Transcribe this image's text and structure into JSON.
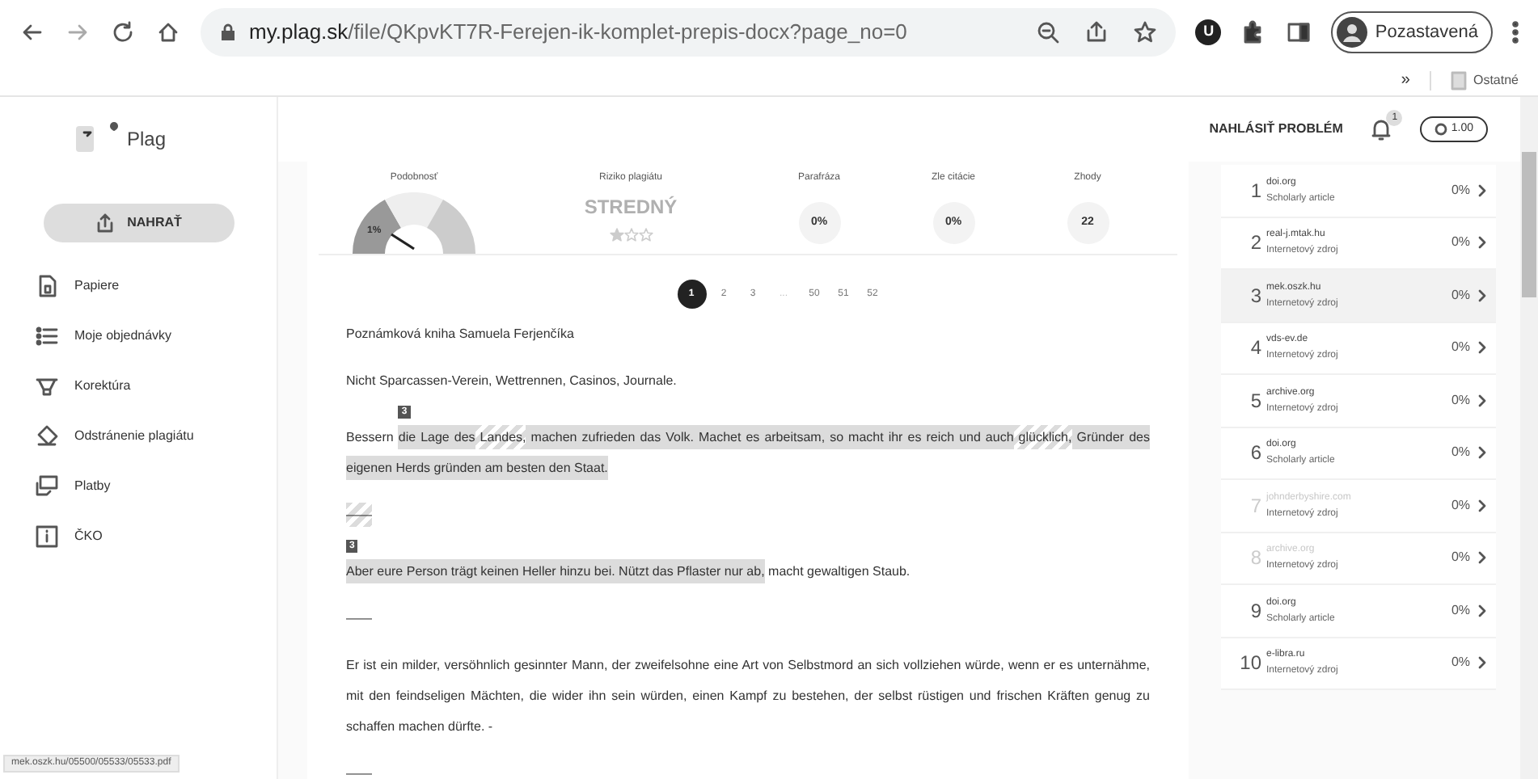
{
  "browser": {
    "url_host": "my.plag.sk",
    "url_path": "/file/QKpvKT7R-Ferejen-ik-komplet-prepis-docx?page_no=0",
    "extension_badge": "U",
    "profile": "Pozastavená",
    "bookmarks_more": "»",
    "bookmarks_folder": "Ostatné"
  },
  "sidebar": {
    "logo": "Plag",
    "upload_button": "NAHRAŤ",
    "items": [
      {
        "label": "Papiere"
      },
      {
        "label": "Moje objednávky"
      },
      {
        "label": "Korektúra"
      },
      {
        "label": "Odstránenie plagiátu"
      },
      {
        "label": "Platby"
      },
      {
        "label": "ČKO"
      }
    ]
  },
  "header": {
    "report_link": "NAHLÁSIŤ PROBLÉM",
    "notification_count": "1",
    "credits": "1.00"
  },
  "stats": {
    "similarity": {
      "label": "Podobnosť",
      "value": "1%"
    },
    "risk": {
      "label": "Riziko plagiátu",
      "value": "STREDNÝ",
      "stars": 1
    },
    "circles": [
      {
        "label": "Parafráza",
        "value": "0%"
      },
      {
        "label": "Zle citácie",
        "value": "0%"
      },
      {
        "label": "Zhody",
        "value": "22"
      }
    ]
  },
  "pagination": [
    {
      "label": "1",
      "selected": true,
      "kind": "page"
    },
    {
      "label": "2",
      "selected": false,
      "kind": "page"
    },
    {
      "label": "3",
      "selected": false,
      "kind": "page"
    },
    {
      "label": "...",
      "kind": "ellipsis"
    },
    {
      "label": "50",
      "selected": false,
      "kind": "page"
    },
    {
      "label": "51",
      "selected": false,
      "kind": "page"
    },
    {
      "label": "52",
      "selected": false,
      "kind": "page"
    }
  ],
  "document": [
    {
      "segments": [
        {
          "kind": "plain",
          "text": "Poznámková kniha Samuela Ferjenčíka"
        }
      ]
    },
    {
      "segments": [
        {
          "kind": "plain",
          "text": "Nicht Sparcassen-Verein, Wettrennen, Casinos, Journale."
        }
      ]
    },
    {
      "segments": [
        {
          "kind": "plain",
          "text": "Bessern "
        },
        {
          "kind": "match",
          "text": "die Lage des",
          "badge": "3"
        },
        {
          "kind": "hatched",
          "text": " Landes,"
        },
        {
          "kind": "match",
          "text": " machen zufrieden das Volk. Machet es arbeitsam, so macht ihr es reich und auch"
        },
        {
          "kind": "hatched",
          "text": " glücklich,"
        },
        {
          "kind": "match",
          "text": " Gründer des eigenen Herds gründen am besten den Staat."
        }
      ]
    },
    {
      "segments": [
        {
          "kind": "hatched",
          "text": "——"
        }
      ]
    },
    {
      "segments": [
        {
          "kind": "match",
          "text": "Aber eure Person trägt keinen Heller hinzu bei. Nützt das Pflaster nur ab,",
          "badge": "3"
        },
        {
          "kind": "plain",
          "text": " macht gewaltigen Staub."
        }
      ]
    },
    {
      "segments": [
        {
          "kind": "plain",
          "text": "——"
        }
      ]
    },
    {
      "segments": [
        {
          "kind": "plain",
          "text": "Er ist ein milder, versöhnlich gesinnter Mann, der zweifelsohne eine Art von Selbstmord an sich vollziehen würde, wenn er es unternähme, mit den feindseligen Mächten, die wider ihn sein würden, einen Kampf zu bestehen, der selbst rüstigen und frischen Kräften genug zu schaffen machen dürfte. -"
        }
      ]
    },
    {
      "segments": [
        {
          "kind": "plain",
          "text": "——"
        }
      ]
    }
  ],
  "sources": [
    {
      "number": "1",
      "domain": "doi.org",
      "type": "Scholarly article",
      "percent": "0%",
      "selected": false,
      "dimmed": false
    },
    {
      "number": "2",
      "domain": "real-j.mtak.hu",
      "type": "Internetový zdroj",
      "percent": "0%",
      "selected": false,
      "dimmed": false
    },
    {
      "number": "3",
      "domain": "mek.oszk.hu",
      "type": "Internetový zdroj",
      "percent": "0%",
      "selected": true,
      "dimmed": false
    },
    {
      "number": "4",
      "domain": "vds-ev.de",
      "type": "Internetový zdroj",
      "percent": "0%",
      "selected": false,
      "dimmed": false
    },
    {
      "number": "5",
      "domain": "archive.org",
      "type": "Internetový zdroj",
      "percent": "0%",
      "selected": false,
      "dimmed": false
    },
    {
      "number": "6",
      "domain": "doi.org",
      "type": "Scholarly article",
      "percent": "0%",
      "selected": false,
      "dimmed": false
    },
    {
      "number": "7",
      "domain": "johnderbyshire.com",
      "type": "Internetový zdroj",
      "percent": "0%",
      "selected": false,
      "dimmed": true
    },
    {
      "number": "8",
      "domain": "archive.org",
      "type": "Internetový zdroj",
      "percent": "0%",
      "selected": false,
      "dimmed": true
    },
    {
      "number": "9",
      "domain": "doi.org",
      "type": "Scholarly article",
      "percent": "0%",
      "selected": false,
      "dimmed": false
    },
    {
      "number": "10",
      "domain": "e-libra.ru",
      "type": "Internetový zdroj",
      "percent": "0%",
      "selected": false,
      "dimmed": false
    }
  ],
  "status_bar": "mek.oszk.hu/05500/05533/05533.pdf"
}
